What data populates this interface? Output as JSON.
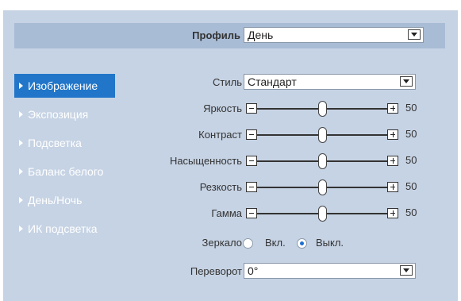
{
  "profile": {
    "label": "Профиль",
    "value": "День"
  },
  "sidebar": {
    "items": [
      {
        "label": "Изображение",
        "active": true
      },
      {
        "label": "Экспозиция",
        "active": false
      },
      {
        "label": "Подсветка",
        "active": false
      },
      {
        "label": "Баланс белого",
        "active": false
      },
      {
        "label": "День/Ночь",
        "active": false
      },
      {
        "label": "ИК подсветка",
        "active": false
      }
    ]
  },
  "settings": {
    "style": {
      "label": "Стиль",
      "value": "Стандарт"
    },
    "sliders": [
      {
        "label": "Яркость",
        "value": "50",
        "min": 0,
        "max": 100
      },
      {
        "label": "Контраст",
        "value": "50",
        "min": 0,
        "max": 100
      },
      {
        "label": "Насыщенность",
        "value": "50",
        "min": 0,
        "max": 100
      },
      {
        "label": "Резкость",
        "value": "50",
        "min": 0,
        "max": 100
      },
      {
        "label": "Гамма",
        "value": "50",
        "min": 0,
        "max": 100
      }
    ],
    "mirror": {
      "label": "Зеркало",
      "options": [
        {
          "label": "Вкл.",
          "checked": false
        },
        {
          "label": "Выкл.",
          "checked": true
        }
      ]
    },
    "flip": {
      "label": "Переворот",
      "value": "0°"
    }
  },
  "colors": {
    "panel_bg": "#c6d3e4",
    "header_bg": "#a9bcd5",
    "active_item_bg": "#2176c9",
    "radio_dot": "#1f6fd1"
  },
  "icons": {
    "dropdown": "chevron-down-icon",
    "sidebar_marker": "caret-right-icon",
    "decrease": "minus-icon",
    "increase": "plus-icon"
  }
}
